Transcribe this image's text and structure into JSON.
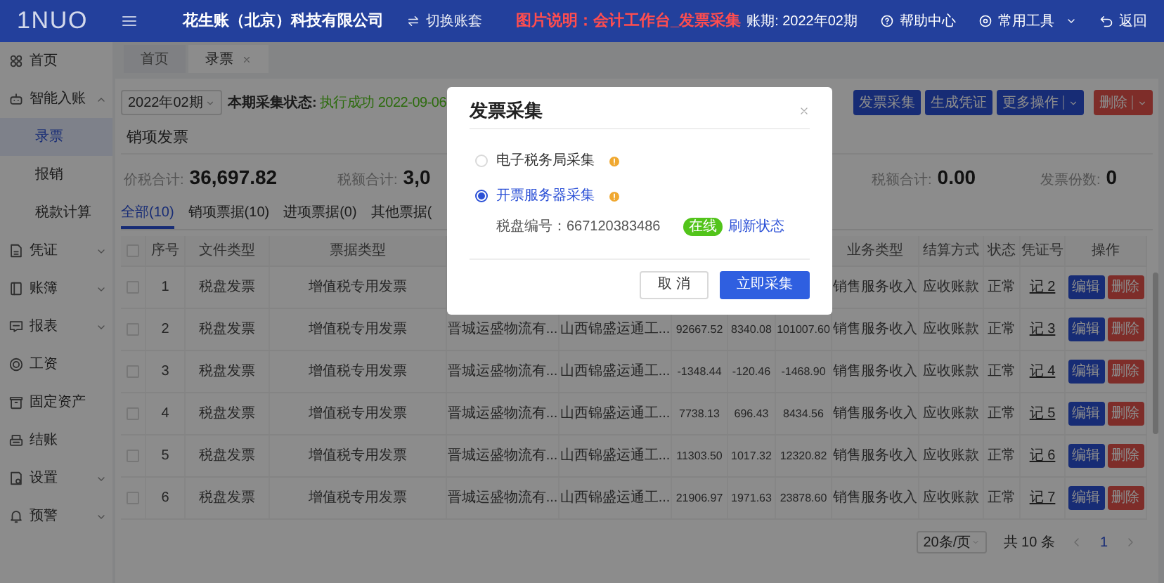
{
  "header": {
    "logo": "1NUO",
    "company": "花生账（北京）科技有限公司",
    "switch_account": "切换账套",
    "caption": "图片说明：会计工作台_发票采集",
    "period": "账期: 2022年02期",
    "help": "帮助中心",
    "tools": "常用工具",
    "back": "返回"
  },
  "sidebar": {
    "items": [
      {
        "kind": "link",
        "label": "首页"
      },
      {
        "kind": "group",
        "label": "智能入账",
        "expanded": true,
        "children": [
          {
            "label": "录票",
            "selected": true
          },
          {
            "label": "报销",
            "selected": false
          },
          {
            "label": "税款计算",
            "selected": false
          }
        ]
      },
      {
        "kind": "group",
        "label": "凭证",
        "expanded": false
      },
      {
        "kind": "group",
        "label": "账簿",
        "expanded": false
      },
      {
        "kind": "group",
        "label": "报表",
        "expanded": false
      },
      {
        "kind": "link",
        "label": "工资"
      },
      {
        "kind": "link",
        "label": "固定资产"
      },
      {
        "kind": "link",
        "label": "结账"
      },
      {
        "kind": "group",
        "label": "设置",
        "expanded": false
      },
      {
        "kind": "group",
        "label": "预警",
        "expanded": false
      }
    ]
  },
  "page_tabs": [
    {
      "label": "首页",
      "selected": false,
      "closable": false
    },
    {
      "label": "录票",
      "selected": true,
      "closable": true
    }
  ],
  "toolbar": {
    "period_select": "2022年02期",
    "status_label": "本期采集状态:",
    "status_value": "执行成功 2022-09-06",
    "buttons": [
      {
        "label": "发票采集",
        "kind": "primary",
        "dropdown": false
      },
      {
        "label": "生成凭证",
        "kind": "primary",
        "dropdown": false
      },
      {
        "label": "更多操作",
        "kind": "primary",
        "dropdown": true
      },
      {
        "label": "删除",
        "kind": "danger",
        "dropdown": true
      }
    ]
  },
  "section_title": "销项发票",
  "summary": [
    {
      "label": "价税合计:",
      "value": "36,697.82"
    },
    {
      "label": "税额合计:",
      "value": "3,0"
    },
    {
      "label": "税额合计:",
      "value": "0.00"
    },
    {
      "label": "发票份数:",
      "value": "0"
    }
  ],
  "sub_tabs": [
    {
      "label": "全部(10)",
      "selected": true
    },
    {
      "label": "销项票据(10)",
      "selected": false
    },
    {
      "label": "进项票据(0)",
      "selected": false
    },
    {
      "label": "其他票据(",
      "selected": false
    }
  ],
  "table": {
    "select_all_checked": false,
    "columns": [
      "序号",
      "文件类型",
      "票据类型",
      "业务类型",
      "结算方式",
      "状态",
      "凭证号",
      "操作"
    ],
    "rows": [
      {
        "checked": false,
        "no": "1",
        "file_type": "税盘发票",
        "invoice_type": "增值税专用发票",
        "business": "销售服务收入",
        "settlement": "应收账款",
        "status": "正常",
        "voucher": "记 2",
        "actions": [
          "编辑",
          "删除"
        ]
      },
      {
        "checked": false,
        "no": "2",
        "file_type": "税盘发票",
        "invoice_type": "增值税专用发票",
        "buyer": "晋城运盛物流有...",
        "seller": "山西锦盛运通工...",
        "amount": "92667.52",
        "tax": "8340.08",
        "total": "101007.60",
        "business": "销售服务收入",
        "settlement": "应收账款",
        "status": "正常",
        "voucher": "记 3",
        "actions": [
          "编辑",
          "删除"
        ]
      },
      {
        "checked": false,
        "no": "3",
        "file_type": "税盘发票",
        "invoice_type": "增值税专用发票",
        "buyer": "晋城运盛物流有...",
        "seller": "山西锦盛运通工...",
        "amount": "-1348.44",
        "tax": "-120.46",
        "total": "-1468.90",
        "business": "销售服务收入",
        "settlement": "应收账款",
        "status": "正常",
        "voucher": "记 4",
        "actions": [
          "编辑",
          "删除"
        ]
      },
      {
        "checked": false,
        "no": "4",
        "file_type": "税盘发票",
        "invoice_type": "增值税专用发票",
        "buyer": "晋城运盛物流有...",
        "seller": "山西锦盛运通工...",
        "amount": "7738.13",
        "tax": "696.43",
        "total": "8434.56",
        "business": "销售服务收入",
        "settlement": "应收账款",
        "status": "正常",
        "voucher": "记 5",
        "actions": [
          "编辑",
          "删除"
        ]
      },
      {
        "checked": false,
        "no": "5",
        "file_type": "税盘发票",
        "invoice_type": "增值税专用发票",
        "buyer": "晋城运盛物流有...",
        "seller": "山西锦盛运通工...",
        "amount": "11303.50",
        "tax": "1017.32",
        "total": "12320.82",
        "business": "销售服务收入",
        "settlement": "应收账款",
        "status": "正常",
        "voucher": "记 6",
        "actions": [
          "编辑",
          "删除"
        ]
      },
      {
        "checked": false,
        "no": "6",
        "file_type": "税盘发票",
        "invoice_type": "增值税专用发票",
        "buyer": "晋城运盛物流有...",
        "seller": "山西锦盛运通工...",
        "amount": "21906.97",
        "tax": "1971.63",
        "total": "23878.60",
        "business": "销售服务收入",
        "settlement": "应收账款",
        "status": "正常",
        "voucher": "记 7",
        "actions": [
          "编辑",
          "删除"
        ]
      }
    ]
  },
  "pagination": {
    "page_size": "20条/页",
    "total": "共 10 条",
    "pages": [
      {
        "label": "1",
        "selected": true
      }
    ]
  },
  "modal": {
    "title": "发票采集",
    "options": [
      {
        "label": "电子税务局采集",
        "selected": false
      },
      {
        "label": "开票服务器采集",
        "selected": true
      }
    ],
    "disk_number": "税盘编号：667120383486",
    "badge": "在线",
    "refresh": "刷新状态",
    "buttons": [
      {
        "label": "取 消",
        "kind": "default"
      },
      {
        "label": "立即采集",
        "kind": "primary"
      }
    ]
  }
}
